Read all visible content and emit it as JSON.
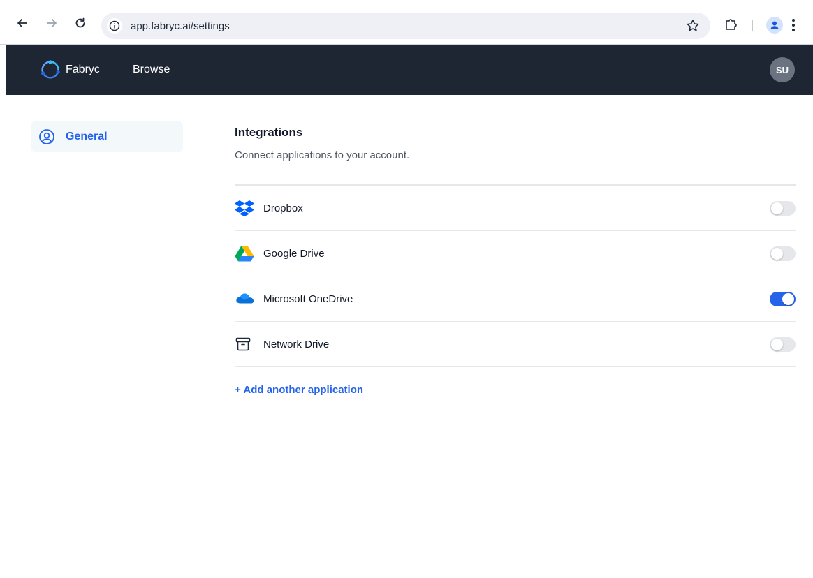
{
  "browser": {
    "url": "app.fabryc.ai/settings",
    "icons": [
      "back-icon",
      "forward-icon",
      "reload-icon",
      "site-info-icon",
      "bookmark-star-icon",
      "extensions-icon",
      "profile-icon",
      "menu-kebab-icon"
    ]
  },
  "header": {
    "brand": "Fabryc",
    "nav_browse": "Browse",
    "avatar_initials": "SU",
    "background": "#1e2533"
  },
  "sidebar": {
    "items": [
      {
        "label": "General",
        "icon": "user-circle-icon",
        "active": true
      }
    ]
  },
  "integrations": {
    "title": "Integrations",
    "subtitle": "Connect applications to your account.",
    "apps": [
      {
        "name": "Dropbox",
        "icon": "dropbox-icon",
        "enabled": false
      },
      {
        "name": "Google Drive",
        "icon": "google-drive-icon",
        "enabled": false
      },
      {
        "name": "Microsoft OneDrive",
        "icon": "onedrive-icon",
        "enabled": true
      },
      {
        "name": "Network Drive",
        "icon": "archive-box-icon",
        "enabled": false
      }
    ],
    "add_link": "+ Add another application"
  },
  "colors": {
    "accent": "#2563eb",
    "toggle_off": "#e5e7eb"
  }
}
